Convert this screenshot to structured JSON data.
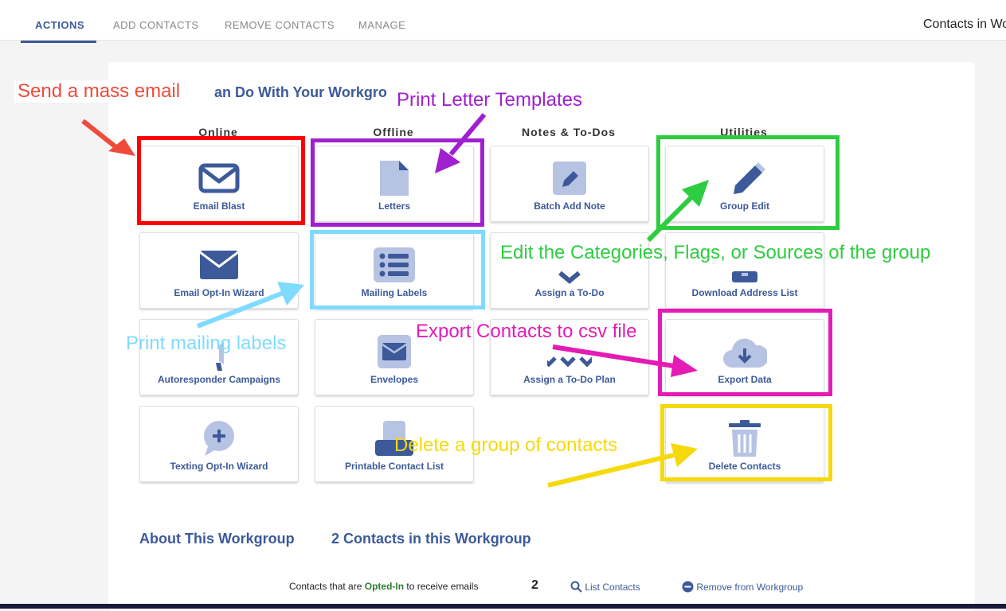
{
  "tabs": [
    "ACTIONS",
    "ADD CONTACTS",
    "REMOVE CONTACTS",
    "MANAGE"
  ],
  "header_right": "Contacts in Wo",
  "section_title": "an Do With Your Workgro",
  "columns": [
    "Online",
    "Offline",
    "Notes & To-Dos",
    "Utilities"
  ],
  "tiles": [
    {
      "label": "Email Blast",
      "icon": "envelope-outline-icon"
    },
    {
      "label": "Letters",
      "icon": "document-icon"
    },
    {
      "label": "Batch Add Note",
      "icon": "pencil-square-icon"
    },
    {
      "label": "Group Edit",
      "icon": "pencil-icon"
    },
    {
      "label": "Email Opt-In Wizard",
      "icon": "envelope-solid-icon"
    },
    {
      "label": "Mailing Labels",
      "icon": "list-icon"
    },
    {
      "label": "Assign a To-Do",
      "icon": "chevron-down-icon"
    },
    {
      "label": "Download Address List",
      "icon": "download-icon"
    },
    {
      "label": "Autoresponder Campaigns",
      "icon": "megaphone-icon"
    },
    {
      "label": "Envelopes",
      "icon": "envelope-square-icon"
    },
    {
      "label": "Assign a To-Do Plan",
      "icon": "chevrons-down-icon"
    },
    {
      "label": "Export Data",
      "icon": "cloud-download-icon"
    },
    {
      "label": "Texting Opt-In Wizard",
      "icon": "chat-plus-icon"
    },
    {
      "label": "Printable Contact List",
      "icon": "printer-icon"
    },
    {
      "label": "Delete Contacts",
      "icon": "trash-icon"
    }
  ],
  "about": {
    "title": "About This Workgroup",
    "count_title": "2 Contacts in this Workgroup"
  },
  "optin_row": {
    "prefix": "Contacts that are",
    "highlight": "Opted-In",
    "suffix": "to receive emails",
    "count": "2",
    "list_link": "List Contacts",
    "remove_link": "Remove from Workgroup"
  },
  "annotations": [
    {
      "text": "Send a mass email",
      "color": "#f04a3a"
    },
    {
      "text": "Print Letter Templates",
      "color": "#a020d0"
    },
    {
      "text": "Edit the Categories, Flags, or Sources of the group",
      "color": "#2ecc40"
    },
    {
      "text": "Print mailing labels",
      "color": "#7fdbff"
    },
    {
      "text": "Export Contacts to csv file",
      "color": "#e41bb5"
    },
    {
      "text": "Delete a group of contacts",
      "color": "#f5d90a"
    }
  ],
  "colors": {
    "accent": "#3c5a99",
    "icon_light": "#b7c3e3",
    "opted_in": "#2e7d32"
  }
}
